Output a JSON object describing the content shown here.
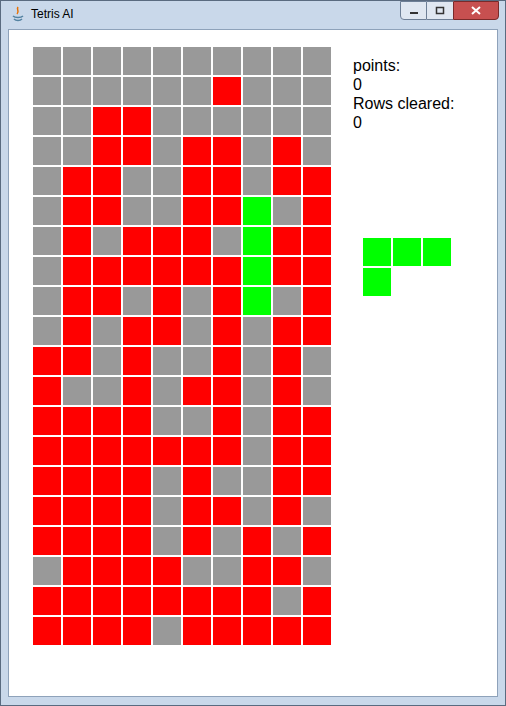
{
  "window": {
    "title": "Tetris AI"
  },
  "score": [
    {
      "label": "points:",
      "value": "0"
    },
    {
      "label": "Rows cleared:",
      "value": "0"
    }
  ],
  "board": {
    "rows": [
      [
        "empty",
        "empty",
        "empty",
        "empty",
        "empty",
        "empty",
        "empty",
        "empty",
        "empty",
        "empty"
      ],
      [
        "empty",
        "empty",
        "empty",
        "empty",
        "empty",
        "empty",
        "block",
        "empty",
        "empty",
        "empty"
      ],
      [
        "empty",
        "empty",
        "block",
        "block",
        "empty",
        "empty",
        "empty",
        "empty",
        "empty",
        "empty"
      ],
      [
        "empty",
        "empty",
        "block",
        "block",
        "empty",
        "block",
        "block",
        "empty",
        "block",
        "empty"
      ],
      [
        "empty",
        "block",
        "block",
        "empty",
        "empty",
        "block",
        "block",
        "empty",
        "block",
        "block"
      ],
      [
        "empty",
        "block",
        "block",
        "empty",
        "empty",
        "block",
        "block",
        "piece",
        "empty",
        "block"
      ],
      [
        "empty",
        "block",
        "empty",
        "block",
        "block",
        "block",
        "empty",
        "piece",
        "block",
        "block"
      ],
      [
        "empty",
        "block",
        "block",
        "block",
        "block",
        "block",
        "block",
        "piece",
        "block",
        "block"
      ],
      [
        "empty",
        "block",
        "block",
        "empty",
        "block",
        "empty",
        "block",
        "piece",
        "empty",
        "block"
      ],
      [
        "empty",
        "block",
        "empty",
        "block",
        "block",
        "empty",
        "block",
        "empty",
        "block",
        "block"
      ],
      [
        "block",
        "block",
        "empty",
        "block",
        "empty",
        "empty",
        "block",
        "empty",
        "block",
        "empty"
      ],
      [
        "block",
        "empty",
        "empty",
        "block",
        "empty",
        "block",
        "block",
        "empty",
        "block",
        "empty"
      ],
      [
        "block",
        "block",
        "block",
        "block",
        "empty",
        "empty",
        "block",
        "empty",
        "block",
        "block"
      ],
      [
        "block",
        "block",
        "block",
        "block",
        "block",
        "block",
        "block",
        "empty",
        "block",
        "block"
      ],
      [
        "block",
        "block",
        "block",
        "block",
        "empty",
        "block",
        "empty",
        "empty",
        "block",
        "block"
      ],
      [
        "block",
        "block",
        "block",
        "block",
        "empty",
        "block",
        "block",
        "empty",
        "block",
        "empty"
      ],
      [
        "block",
        "block",
        "block",
        "block",
        "empty",
        "block",
        "empty",
        "block",
        "empty",
        "block"
      ],
      [
        "empty",
        "block",
        "block",
        "block",
        "block",
        "empty",
        "empty",
        "block",
        "block",
        "empty"
      ],
      [
        "block",
        "block",
        "block",
        "block",
        "block",
        "block",
        "block",
        "block",
        "empty",
        "block"
      ],
      [
        "block",
        "block",
        "block",
        "block",
        "empty",
        "block",
        "block",
        "block",
        "block",
        "block"
      ]
    ]
  },
  "next_piece": {
    "cells": [
      [
        true,
        true,
        true
      ],
      [
        true,
        false,
        false
      ]
    ]
  }
}
